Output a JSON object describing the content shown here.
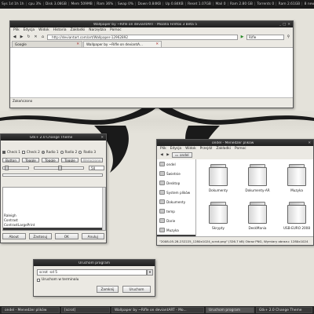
{
  "top_panel": {
    "segments": [
      "Sys 1d 1h 1h",
      "cpu 3%",
      "Disk 3.08GB",
      "Mem 509MB",
      "Ram 36%",
      "Swap 0%",
      "Down 0.84KB",
      "Up 0.84KB",
      "Reset 1.07GB",
      "Mail 0",
      "Ram 2.80 GB",
      "Torrents 0",
      "Ram 2.61GB",
      "8 new messages",
      "Weather Mostly Cloudy 18°C",
      "Sat 7 Jun",
      "Lucky"
    ]
  },
  "firefox": {
    "title": "Wallpaper by ~Rifle on deviantART - Mozilla Firefox 3 Beta 5",
    "menu": [
      "Plik",
      "Edycja",
      "Widok",
      "Historia",
      "Zakładki",
      "Narzędzia",
      "Pomoc"
    ],
    "url": "http://deviantart.com/art/Wallpaper-12962892",
    "search_value": "Rifle",
    "tabs": [
      {
        "label": "Google",
        "selected": false
      },
      {
        "label": "Wallpaper by ~Rifle on deviantA...",
        "selected": true
      }
    ],
    "status": "Zakończono"
  },
  "gtk": {
    "title": "Gtk+ 2.0 Change Theme",
    "checks": [
      {
        "label": "Check 1",
        "checked": true
      },
      {
        "label": "Check 2",
        "checked": false
      }
    ],
    "radios": [
      {
        "label": "Radio 1",
        "checked": true
      },
      {
        "label": "Radio 2",
        "checked": false
      },
      {
        "label": "Radio 3",
        "checked": false
      }
    ],
    "toggles": [
      "Button",
      "Toggle",
      "Toggle",
      "Toggle",
      "Wyłączone"
    ],
    "spin_value": "50",
    "slider_value": 0.52,
    "themes": [
      "",
      "",
      "",
      "",
      "",
      "Raleigh",
      "Contrast",
      "ContrastLargePrint",
      "",
      "",
      "",
      "",
      "Clearlooks",
      "NomeCandy"
    ],
    "selected_theme_index": 8,
    "footer": {
      "about": "About",
      "apply": "Zastosuj",
      "ok": "OK",
      "cancel": "Anuluj"
    }
  },
  "nautilus": {
    "title": "ondel - Menedżer plików",
    "menu": [
      "Plik",
      "Edycja",
      "Widok",
      "Przejdź",
      "Zakładki",
      "Pomoc"
    ],
    "crumb": "ondel",
    "places": [
      {
        "label": "ondel",
        "selected": false
      },
      {
        "label": "Świetnie",
        "selected": false
      },
      {
        "label": "Desktop",
        "selected": false
      },
      {
        "label": "System plików",
        "selected": false
      },
      {
        "label": "Dokumenty",
        "selected": false
      },
      {
        "label": "temp",
        "selected": false
      },
      {
        "label": "Darie",
        "selected": false
      },
      {
        "label": "Muzyka",
        "selected": false
      },
      {
        "label": "Tapety",
        "selected": true
      }
    ],
    "files": [
      "Dokumenty",
      "Dokumenty-AR",
      "Muzyka",
      "Skrypty",
      "DeskMania",
      "USB-EURO 2008"
    ],
    "status": "\"2008-05-28-232225_1280x1024_scrot.png\" (326.7 kB) Obraz PNG, Wymiary obrazu: 1280x1024"
  },
  "run_dialog": {
    "title": "Uruchom program",
    "input_value": "scrot -sd 5",
    "terminal_label": "Uruchom w terminalu",
    "close_button": "Zamknij",
    "run_button": "Uruchom"
  },
  "taskbar": {
    "items": [
      {
        "label": "ondel - Menedżer plików",
        "active": false
      },
      {
        "label": "[scrot]",
        "active": false
      },
      {
        "label": "Wallpaper by ~Rifle on deviantART - Mo...",
        "active": false
      },
      {
        "label": "Uruchom program",
        "active": true
      },
      {
        "label": "Gtk+ 2.0 Change Theme",
        "active": false
      }
    ]
  }
}
